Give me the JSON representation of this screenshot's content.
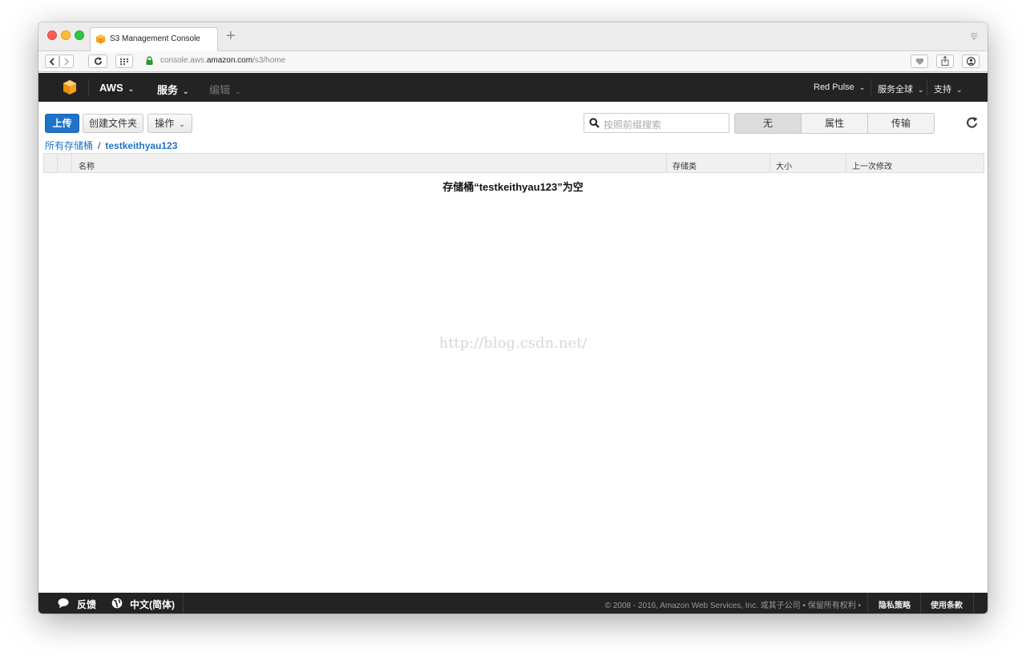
{
  "browser": {
    "tab_title": "S3 Management Console",
    "new_tab_symbol": "+",
    "url_prefix": "console.aws.",
    "url_domain": "amazon.com",
    "url_path": "/s3/home"
  },
  "aws_header": {
    "brand": "AWS",
    "services": "服务",
    "edit": "编辑",
    "account": "Red Pulse",
    "region": "服务全球",
    "support": "支持",
    "caret": "⌄"
  },
  "toolbar": {
    "upload": "上传",
    "create_folder": "创建文件夹",
    "actions": "操作",
    "search_placeholder": "按照前缀搜索",
    "view_none": "无",
    "view_properties": "属性",
    "view_transfers": "传输"
  },
  "breadcrumb": {
    "all_buckets": "所有存储桶",
    "separator": "/",
    "bucket": "testkeithyau123"
  },
  "table": {
    "headers": [
      "名称",
      "存储类",
      "大小",
      "上一次修改"
    ],
    "empty_message": "存储桶“testkeithyau123”为空"
  },
  "watermark": "http://blog.csdn.net/",
  "footer": {
    "feedback": "反馈",
    "language": "中文(简体)",
    "copyright": "© 2008 - 2016, Amazon Web Services, Inc. 或其子公司 • 保留所有权利 •",
    "privacy": "隐私策略",
    "terms": "使用条款"
  },
  "colors": {
    "accent": "#1f73c8",
    "header_bg": "#232323",
    "aws_orange": "#f7a21b"
  }
}
